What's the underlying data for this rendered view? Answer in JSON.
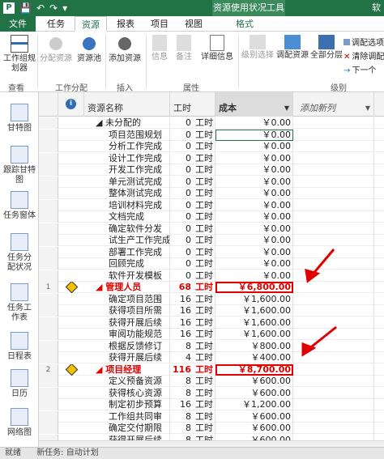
{
  "title_bar": {
    "context_tab": "资源使用状况工具",
    "app_name": "软"
  },
  "tabs": [
    {
      "label": "文件"
    },
    {
      "label": "任务"
    },
    {
      "label": "资源"
    },
    {
      "label": "报表"
    },
    {
      "label": "项目"
    },
    {
      "label": "视图"
    },
    {
      "label": "格式"
    }
  ],
  "ribbon": {
    "buttons": {
      "team_planner": "工作组规划器",
      "assign_resources": "分配资源",
      "resource_pool": "资源池",
      "add_resources": "添加资源",
      "info": "信息",
      "notes": "备注",
      "details": "详细信息",
      "level_selection": "级别选择",
      "level_resource": "调配资源",
      "level_all": "全部分层",
      "leveling_options": "调配选项",
      "clear_leveling": "清除调配",
      "next_overallocation": "下一个"
    },
    "groups": {
      "view": "查看",
      "assignments": "工作分配",
      "insert": "插入",
      "properties": "属性",
      "level": "级别"
    }
  },
  "sidebar": {
    "items": [
      {
        "label": "甘特图"
      },
      {
        "label": "跟踪甘特图"
      },
      {
        "label": "任务窗体"
      },
      {
        "label": "任务分配状况"
      },
      {
        "label": "任务工作表"
      },
      {
        "label": "日程表"
      },
      {
        "label": "日历"
      },
      {
        "label": "网络图"
      }
    ]
  },
  "grid": {
    "headers": {
      "info": "i",
      "name": "资源名称",
      "work": "工时",
      "cost": "成本",
      "add_column": "添加新列"
    },
    "rows": [
      {
        "id": "",
        "name": "◢ 未分配的",
        "work": "0",
        "unit": "工时",
        "cost": "￥0.00"
      },
      {
        "id": "",
        "name": "项目范围规划",
        "work": "0",
        "unit": "工时",
        "cost": "￥0.00"
      },
      {
        "id": "",
        "name": "分析工作完成",
        "work": "0",
        "unit": "工时",
        "cost": "￥0.00"
      },
      {
        "id": "",
        "name": "设计工作完成",
        "work": "0",
        "unit": "工时",
        "cost": "￥0.00"
      },
      {
        "id": "",
        "name": "开发工作完成",
        "work": "0",
        "unit": "工时",
        "cost": "￥0.00"
      },
      {
        "id": "",
        "name": "单元测试完成",
        "work": "0",
        "unit": "工时",
        "cost": "￥0.00"
      },
      {
        "id": "",
        "name": "整体测试完成",
        "work": "0",
        "unit": "工时",
        "cost": "￥0.00"
      },
      {
        "id": "",
        "name": "培训材料完成",
        "work": "0",
        "unit": "工时",
        "cost": "￥0.00"
      },
      {
        "id": "",
        "name": "文档完成",
        "work": "0",
        "unit": "工时",
        "cost": "￥0.00"
      },
      {
        "id": "",
        "name": "确定软件分发",
        "work": "0",
        "unit": "工时",
        "cost": "￥0.00"
      },
      {
        "id": "",
        "name": "试生产工作完成",
        "work": "0",
        "unit": "工时",
        "cost": "￥0.00"
      },
      {
        "id": "",
        "name": "部署工作完成",
        "work": "0",
        "unit": "工时",
        "cost": "￥0.00"
      },
      {
        "id": "",
        "name": "回顾完成",
        "work": "0",
        "unit": "工时",
        "cost": "￥0.00"
      },
      {
        "id": "",
        "name": "软件开发模板",
        "work": "0",
        "unit": "工时",
        "cost": "￥0.00"
      },
      {
        "id": "1",
        "name": "◢ 管理人员",
        "work": "68",
        "unit": "工时",
        "cost": "￥6,800.00",
        "bold": true,
        "warn": true
      },
      {
        "id": "",
        "name": "确定项目范围",
        "work": "16",
        "unit": "工时",
        "cost": "￥1,600.00"
      },
      {
        "id": "",
        "name": "获得项目所需",
        "work": "16",
        "unit": "工时",
        "cost": "￥1,600.00"
      },
      {
        "id": "",
        "name": "获得开展后续",
        "work": "16",
        "unit": "工时",
        "cost": "￥1,600.00"
      },
      {
        "id": "",
        "name": "审阅功能规范",
        "work": "16",
        "unit": "工时",
        "cost": "￥1,600.00"
      },
      {
        "id": "",
        "name": "根据反馈修订",
        "work": "8",
        "unit": "工时",
        "cost": "￥800.00"
      },
      {
        "id": "",
        "name": "获得开展后续",
        "work": "4",
        "unit": "工时",
        "cost": "￥400.00"
      },
      {
        "id": "2",
        "name": "◢ 项目经理",
        "work": "116",
        "unit": "工时",
        "cost": "￥8,700.00",
        "bold": true,
        "warn": true
      },
      {
        "id": "",
        "name": "定义预备资源",
        "work": "8",
        "unit": "工时",
        "cost": "￥600.00"
      },
      {
        "id": "",
        "name": "获得核心资源",
        "work": "8",
        "unit": "工时",
        "cost": "￥600.00"
      },
      {
        "id": "",
        "name": "制定初步预算",
        "work": "16",
        "unit": "工时",
        "cost": "￥1,200.00"
      },
      {
        "id": "",
        "name": "工作组共同审",
        "work": "8",
        "unit": "工时",
        "cost": "￥600.00"
      },
      {
        "id": "",
        "name": "确定交付期限",
        "work": "8",
        "unit": "工时",
        "cost": "￥600.00"
      },
      {
        "id": "",
        "name": "获得开展后续",
        "work": "8",
        "unit": "工时",
        "cost": "￥600.00"
      }
    ]
  },
  "status_bar": {
    "left": "就绪",
    "mode": "新任务: 自动计划"
  },
  "colors": {
    "accent": "#217346",
    "highlight": "#e00000",
    "warning": "#f2c200"
  }
}
